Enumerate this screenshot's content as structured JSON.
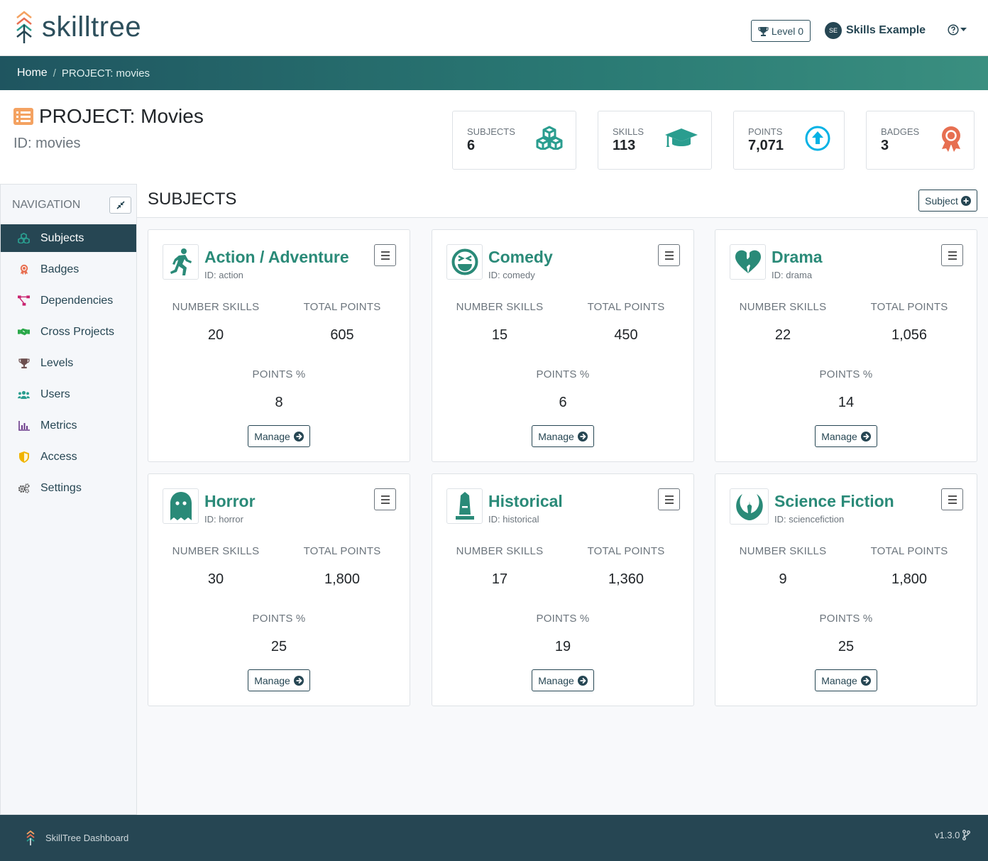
{
  "app": {
    "brand": "skilltree",
    "footer_brand": "SkillTree Dashboard",
    "version": "v1.3.0"
  },
  "header": {
    "level_label": "Level 0",
    "user_initials": "SE",
    "user_name": "Skills Example"
  },
  "breadcrumb": {
    "home": "Home",
    "current": "PROJECT: movies"
  },
  "project": {
    "title": "PROJECT: Movies",
    "id_label": "ID: movies"
  },
  "stats": [
    {
      "label": "SUBJECTS",
      "value": "6",
      "icon": "cubes-icon",
      "color": "#2a9d8f"
    },
    {
      "label": "SKILLS",
      "value": "113",
      "icon": "graduation-cap-icon",
      "color": "#2a9d8f"
    },
    {
      "label": "POINTS",
      "value": "7,071",
      "icon": "arrow-circle-up-icon",
      "color": "#03b2e5"
    },
    {
      "label": "BADGES",
      "value": "3",
      "icon": "award-icon",
      "color": "#e76f51"
    }
  ],
  "nav": {
    "title": "NAVIGATION",
    "items": [
      {
        "label": "Subjects",
        "icon": "cubes-icon",
        "color": "#2a9d8f"
      },
      {
        "label": "Badges",
        "icon": "award-icon",
        "color": "#e76f51"
      },
      {
        "label": "Dependencies",
        "icon": "project-diagram-icon",
        "color": "#c9236f"
      },
      {
        "label": "Cross Projects",
        "icon": "handshake-icon",
        "color": "#2aa84a"
      },
      {
        "label": "Levels",
        "icon": "trophy-icon",
        "color": "#6c4f4f"
      },
      {
        "label": "Users",
        "icon": "users-icon",
        "color": "#2a9d8f"
      },
      {
        "label": "Metrics",
        "icon": "chart-bar-icon",
        "color": "#6b3a8a"
      },
      {
        "label": "Access",
        "icon": "shield-icon",
        "color": "#f0b400"
      },
      {
        "label": "Settings",
        "icon": "cogs-icon",
        "color": "#555555"
      }
    ]
  },
  "subjects": {
    "title": "SUBJECTS",
    "add_label": "Subject",
    "labels": {
      "skills": "NUMBER SKILLS",
      "points": "TOTAL POINTS",
      "percent": "POINTS %",
      "manage": "Manage"
    },
    "items": [
      {
        "name": "Action / Adventure",
        "id": "ID: action",
        "skills": "20",
        "points": "605",
        "percent": "8",
        "icon": "running-icon"
      },
      {
        "name": "Comedy",
        "id": "ID: comedy",
        "skills": "15",
        "points": "450",
        "percent": "6",
        "icon": "laugh-squint-icon"
      },
      {
        "name": "Drama",
        "id": "ID: drama",
        "skills": "22",
        "points": "1,056",
        "percent": "14",
        "icon": "heart-broken-icon"
      },
      {
        "name": "Horror",
        "id": "ID: horror",
        "skills": "30",
        "points": "1,800",
        "percent": "25",
        "icon": "ghost-icon"
      },
      {
        "name": "Historical",
        "id": "ID: historical",
        "skills": "17",
        "points": "1,360",
        "percent": "19",
        "icon": "monument-icon"
      },
      {
        "name": "Science Fiction",
        "id": "ID: sciencefiction",
        "skills": "9",
        "points": "1,800",
        "percent": "25",
        "icon": "jedi-order-icon"
      }
    ]
  }
}
